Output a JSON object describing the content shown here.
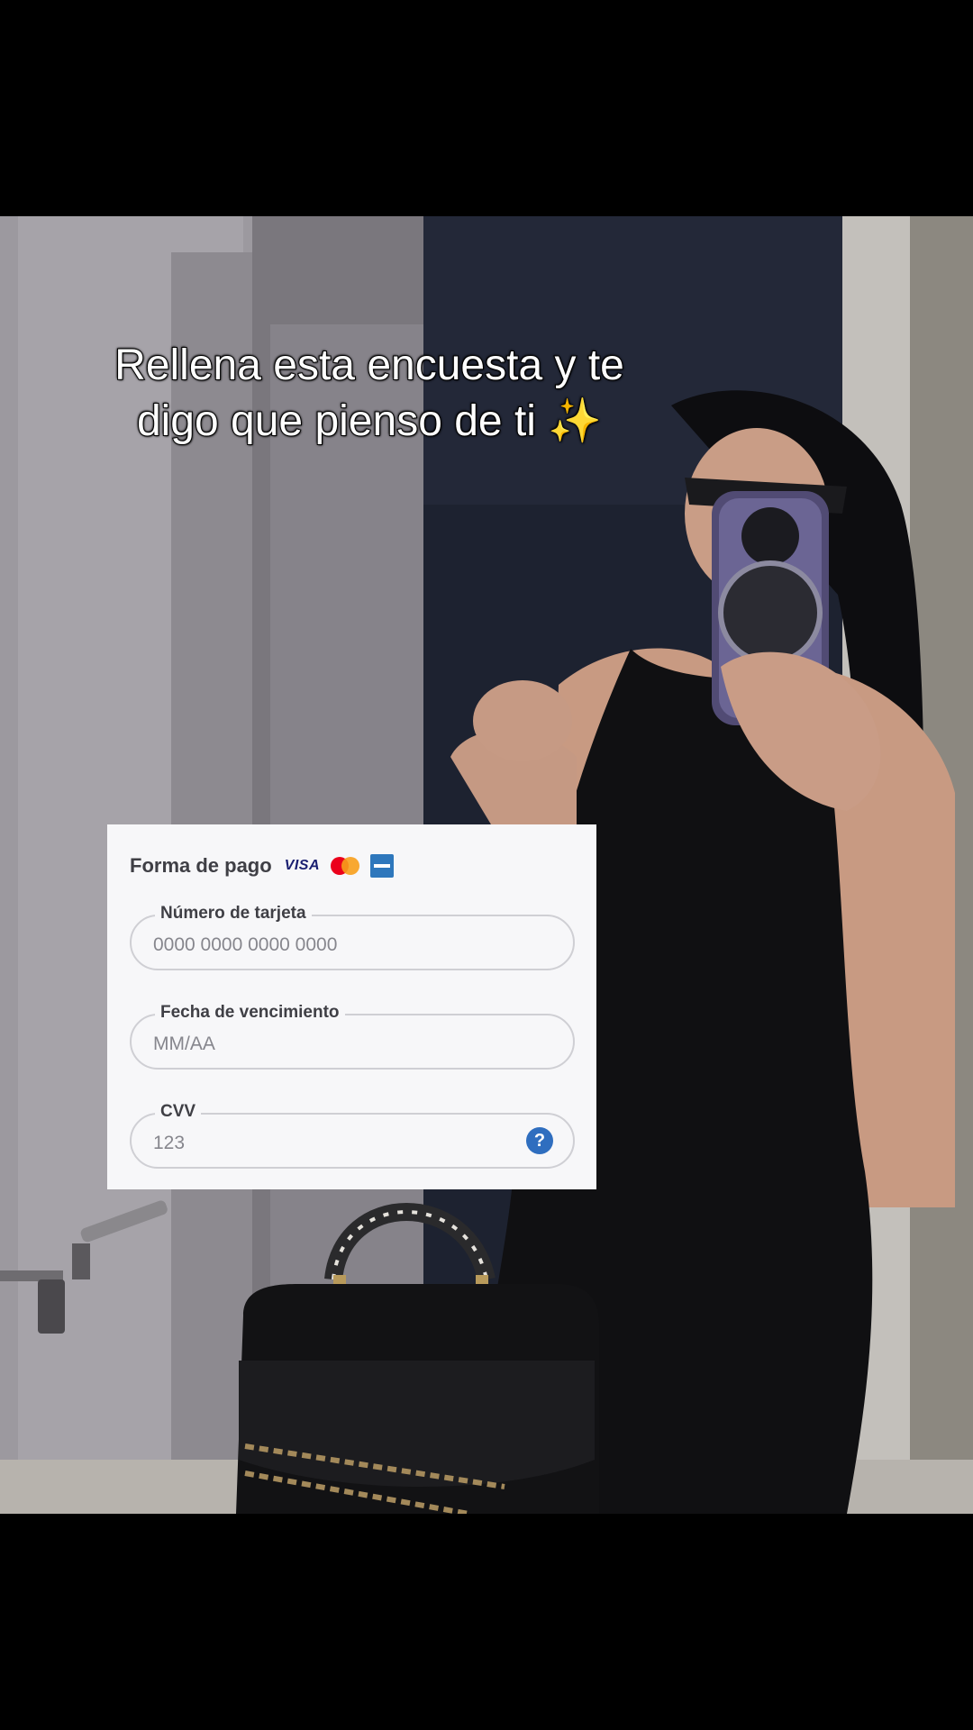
{
  "caption": {
    "line1": "Rellena esta encuesta y te",
    "line2": "digo que pienso de ti",
    "emoji": "✨"
  },
  "payment_form": {
    "title": "Forma de pago",
    "brand_logos": [
      "visa-logo",
      "mastercard-logo",
      "amex-logo"
    ],
    "visa_text": "VISA",
    "fields": [
      {
        "label": "Número de tarjeta",
        "placeholder": "0000 0000 0000 0000"
      },
      {
        "label": "Fecha de vencimiento",
        "placeholder": "MM/AA"
      },
      {
        "label": "CVV",
        "placeholder": "123",
        "help_icon": "question-circle-icon",
        "help_glyph": "?"
      }
    ]
  },
  "colors": {
    "help_icon": "#2f6ebf",
    "caption_text": "#ffffff",
    "card_background": "#f7f7f9"
  }
}
